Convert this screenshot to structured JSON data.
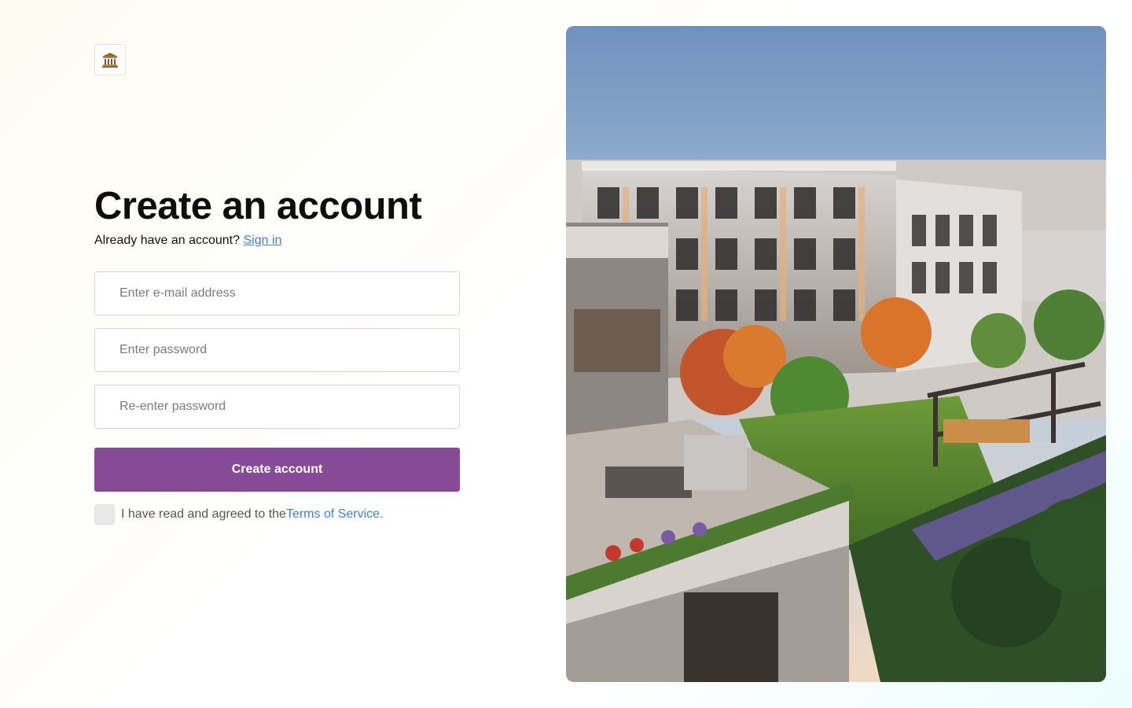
{
  "logo": {
    "icon": "bank-building-icon"
  },
  "form": {
    "title": "Create an account",
    "signin_prompt": "Already have an account?",
    "signin_link": "Sign in",
    "email_placeholder": "Enter e-mail address",
    "password_placeholder": "Enter password",
    "confirm_placeholder": "Re-enter password",
    "submit_label": "Create account",
    "terms_prefix": "I have read and agreed to the ",
    "terms_link": "Terms of Service",
    "terms_suffix": "."
  },
  "hero": {
    "image": "apartment-courtyard-rendering"
  },
  "colors": {
    "primary_button": "#874a97",
    "link": "#3f7fd8"
  }
}
